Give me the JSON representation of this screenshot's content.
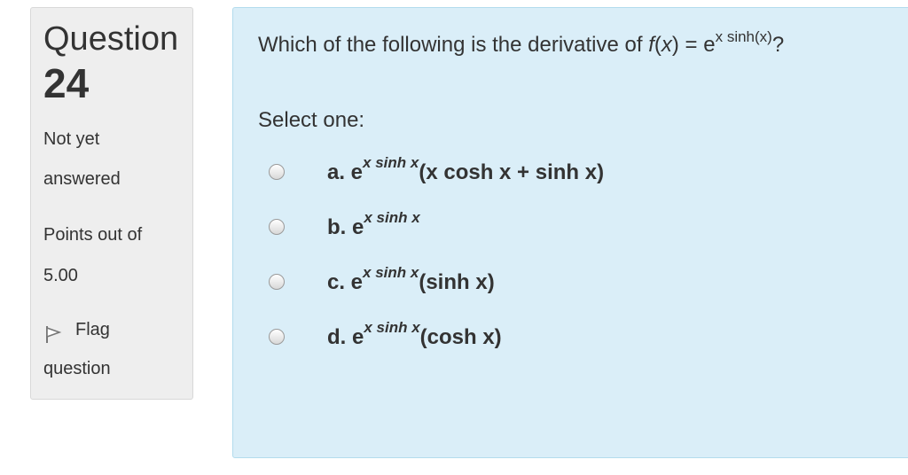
{
  "info": {
    "question_label": "Question",
    "question_number": "24",
    "state_line1": "Not yet",
    "state_line2": "answered",
    "points_line1": "Points out of",
    "points_value": "5.00",
    "flag_line1": "Flag",
    "flag_line2": "question",
    "flag_icon": "flag-icon"
  },
  "question": {
    "prefix": "Which of the following is the derivative of ",
    "fx": "f",
    "paren_open": "(",
    "x": "x",
    "paren_close": ") = e",
    "exp": "x sinh(x)",
    "suffix": "?"
  },
  "prompt": "Select one:",
  "options": [
    {
      "letter": "a. e",
      "exp": "x sinh x",
      "rest": "(x cosh x + sinh x)"
    },
    {
      "letter": "b. e",
      "exp": "x sinh x",
      "rest": ""
    },
    {
      "letter": "c. e",
      "exp": "x sinh x",
      "rest": "(sinh x)"
    },
    {
      "letter": "d. e",
      "exp": "x sinh x",
      "rest": "(cosh x)"
    }
  ]
}
